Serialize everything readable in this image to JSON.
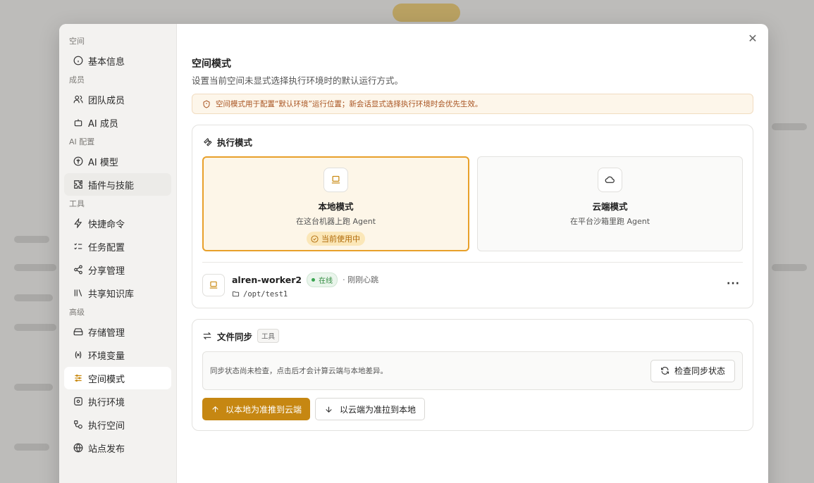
{
  "sidebar": {
    "sections": [
      {
        "title": "空间",
        "items": [
          {
            "label": "基本信息",
            "icon": "info-icon"
          }
        ]
      },
      {
        "title": "成员",
        "items": [
          {
            "label": "团队成员",
            "icon": "users-icon"
          },
          {
            "label": "AI 成员",
            "icon": "bot-icon"
          }
        ]
      },
      {
        "title": "AI 配置",
        "items": [
          {
            "label": "AI 模型",
            "icon": "model-icon"
          },
          {
            "label": "插件与技能",
            "icon": "puzzle-icon"
          }
        ]
      },
      {
        "title": "工具",
        "items": [
          {
            "label": "快捷命令",
            "icon": "zap-icon"
          },
          {
            "label": "任务配置",
            "icon": "checklist-icon"
          },
          {
            "label": "分享管理",
            "icon": "share-icon"
          },
          {
            "label": "共享知识库",
            "icon": "library-icon"
          }
        ]
      },
      {
        "title": "高级",
        "items": [
          {
            "label": "存储管理",
            "icon": "storage-icon"
          },
          {
            "label": "环境变量",
            "icon": "variable-icon"
          },
          {
            "label": "空间模式",
            "icon": "sliders-icon"
          },
          {
            "label": "执行环境",
            "icon": "environment-icon"
          },
          {
            "label": "执行空间",
            "icon": "workspace-icon"
          },
          {
            "label": "站点发布",
            "icon": "globe-icon"
          }
        ]
      }
    ],
    "active_item": "空间模式",
    "hover_item": "插件与技能"
  },
  "main": {
    "title": "空间模式",
    "description": "设置当前空间未显式选择执行环境时的默认运行方式。",
    "alert": "空间模式用于配置“默认环境”运行位置；新会话显式选择执行环境时会优先生效。",
    "exec_mode": {
      "heading": "执行模式",
      "options": [
        {
          "name": "本地模式",
          "sub": "在这台机器上跑 Agent",
          "icon": "laptop-icon",
          "selected": true,
          "badge": "当前使用中"
        },
        {
          "name": "云端模式",
          "sub": "在平台沙箱里跑 Agent",
          "icon": "cloud-icon",
          "selected": false
        }
      ],
      "worker": {
        "name": "alren-worker2",
        "status": "在线",
        "heartbeat": "· 刚刚心跳",
        "path": "/opt/test1",
        "more": "···"
      }
    },
    "file_sync": {
      "heading": "文件同步",
      "tag": "工具",
      "status_text": "同步状态尚未检查，点击后才会计算云端与本地差异。",
      "check_button": "检查同步状态",
      "push_button": "以本地为准推到云端",
      "pull_button": "以云端为准拉到本地"
    }
  },
  "colors": {
    "accent": "#c68712",
    "selected_border": "#e8a02a",
    "online": "#3aa551",
    "alert_text": "#a8521f"
  }
}
